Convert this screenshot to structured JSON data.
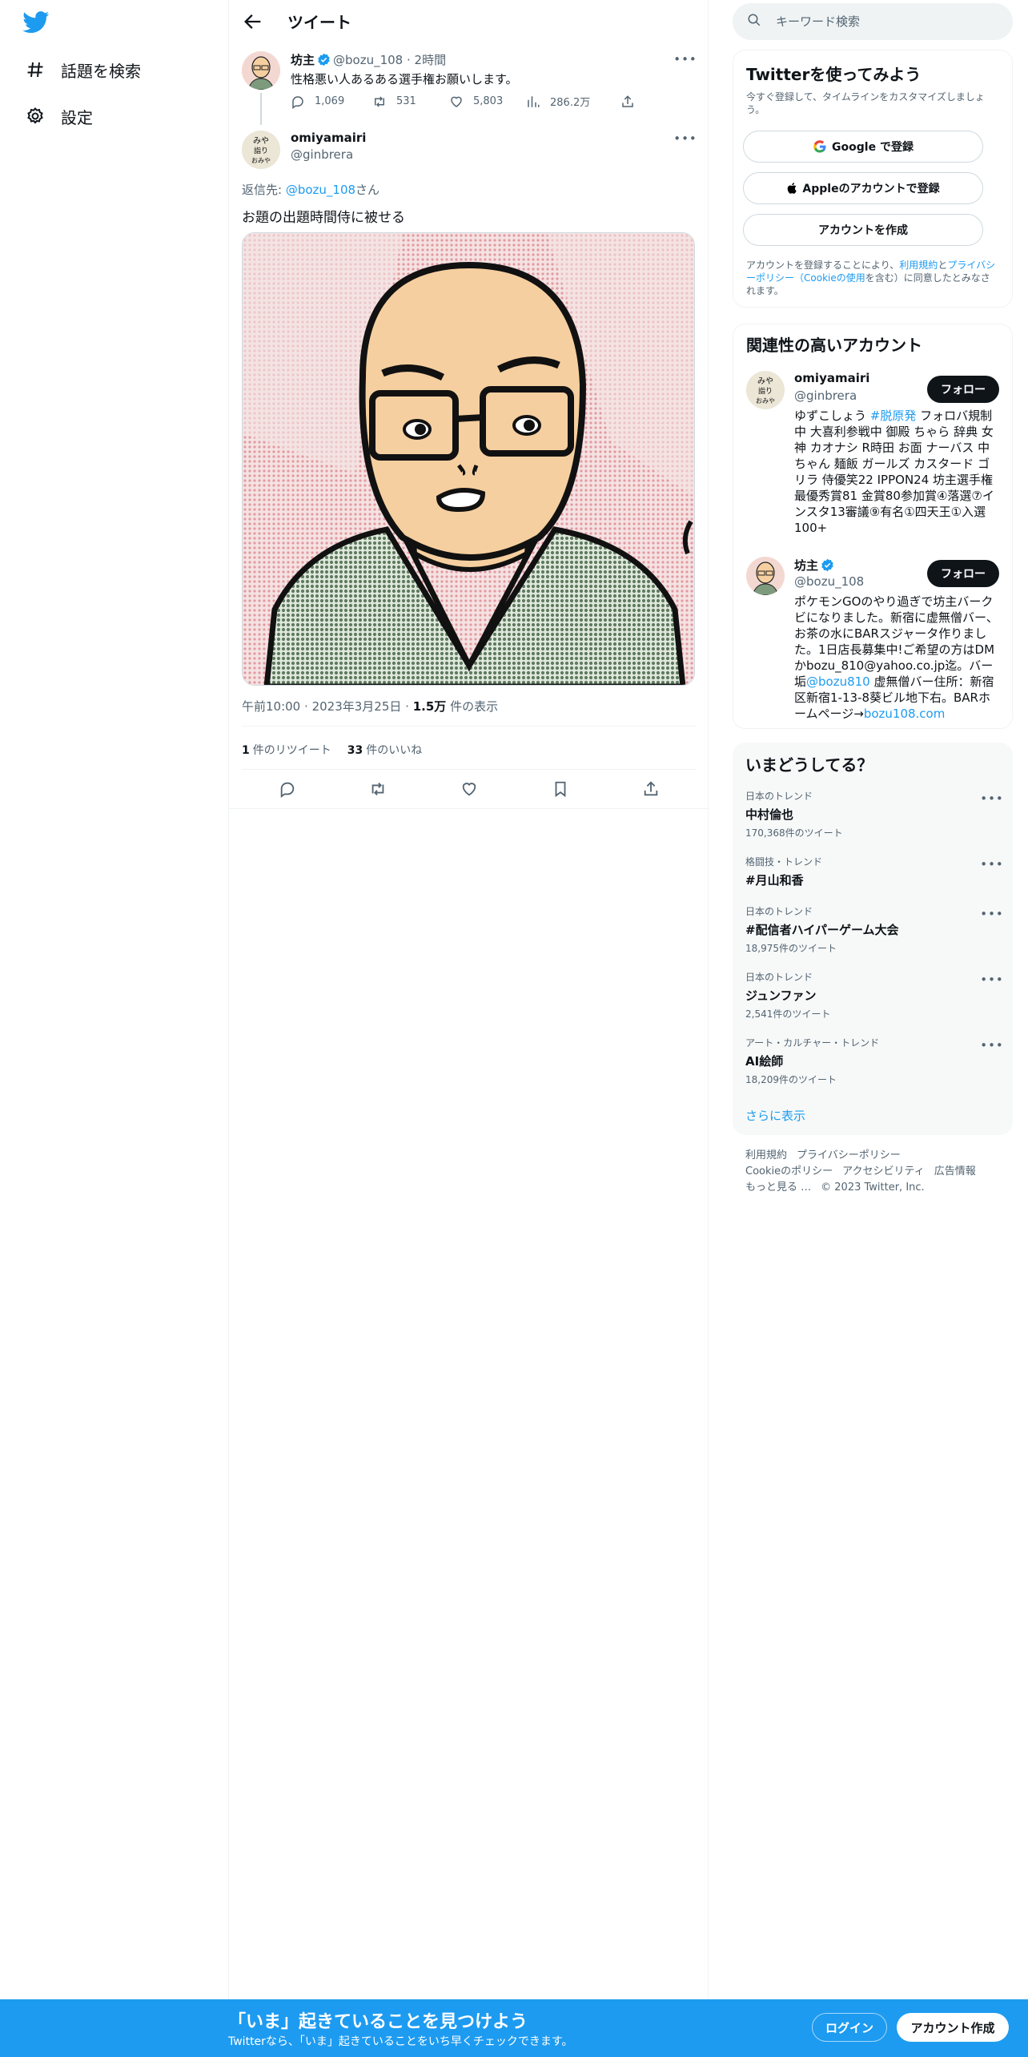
{
  "nav": {
    "explore": "話題を検索",
    "settings": "設定"
  },
  "header": {
    "title": "ツイート"
  },
  "tweet1": {
    "name": "坊主",
    "handle": "@bozu_108",
    "time": "2時間",
    "text": "性格悪い人あるある選手権お願いします。",
    "replies": "1,069",
    "retweets": "531",
    "likes": "5,803",
    "views": "286.2万"
  },
  "tweet2": {
    "name": "omiyamairi",
    "handle": "@ginbrera",
    "reply_prefix": "返信先: ",
    "reply_to": "@bozu_108",
    "reply_suffix": "さん",
    "text": "お題の出題時間侍に被せる",
    "time": "午前10:00",
    "date": "2023年3月25日",
    "views_count": "1.5万",
    "views_label": "件の表示",
    "retweet_count": "1",
    "retweet_label": "件のリツイート",
    "like_count": "33",
    "like_label": "件のいいね"
  },
  "search": {
    "placeholder": "キーワード検索"
  },
  "signup_card": {
    "title": "Twitterを使ってみよう",
    "desc": "今すぐ登録して、タイムラインをカスタマイズしましょう。",
    "google": "Google で登録",
    "apple": "Appleのアカウントで登録",
    "create": "アカウントを作成",
    "terms_1": "アカウントを登録することにより、",
    "terms_link1": "利用規約",
    "terms_2": "と",
    "terms_link2": "プライバシーポリシー（Cookieの使用",
    "terms_3": "を含む）に同意したとみなされます。"
  },
  "related": {
    "title": "関連性の高いアカウント",
    "follow_label": "フォロー",
    "accounts": [
      {
        "name": "omiyamairi",
        "handle": "@ginbrera",
        "bio_1": "ゆずこしょう ",
        "bio_tag": "#脱原発",
        "bio_2": " フォロバ規制中 大喜利参戦中 御殿 ちゃら 辞典 女神 カオナシ R時田 お面 ナーバス 中ちゃん 麺飯 ガールズ カスタード ゴリラ 侍優笑22 IPPON24 坊主選手権最優秀賞81 金賞80参加賞④落選⑦インスタ13審議⑨有名①四天王①入選100+"
      },
      {
        "name": "坊主",
        "handle": "@bozu_108",
        "bio_1": "ポケモンGOのやり過ぎで坊主バークビになりました。新宿に虚無僧バー、お茶の水にBARスジャータ作りました。1日店長募集中!ご希望の方はDMかbozu_810@yahoo.co.jp迄。バー垢",
        "bio_mention": "@bozu810",
        "bio_2": " 虚無僧バー住所：新宿区新宿1-13-8葵ビル地下右。BARホームページ→",
        "bio_link": "bozu108.com"
      }
    ]
  },
  "trends": {
    "title": "いまどうしてる？",
    "items": [
      {
        "category": "日本のトレンド",
        "topic": "中村倫也",
        "count": "170,368件のツイート"
      },
      {
        "category": "格闘技・トレンド",
        "topic": "#月山和香",
        "count": ""
      },
      {
        "category": "日本のトレンド",
        "topic": "#配信者ハイパーゲーム大会",
        "count": "18,975件のツイート"
      },
      {
        "category": "日本のトレンド",
        "topic": "ジュンファン",
        "count": "2,541件のツイート"
      },
      {
        "category": "アート・カルチャー・トレンド",
        "topic": "AI絵師",
        "count": "18,209件のツイート"
      }
    ],
    "show_more": "さらに表示"
  },
  "footer": {
    "links": [
      "利用規約",
      "プライバシーポリシー",
      "Cookieのポリシー",
      "アクセシビリティ",
      "広告情報",
      "もっと見る …"
    ],
    "copyright": "© 2023 Twitter, Inc."
  },
  "bottom_bar": {
    "title": "「いま」起きていることを見つけよう",
    "subtitle": "Twitterなら、「いま」起きていることをいち早くチェックできます。",
    "login": "ログイン",
    "signup": "アカウント作成"
  },
  "colors": {
    "accent": "#1d9bf0",
    "text": "#0f1419",
    "secondary": "#536471",
    "border": "#eff3f4"
  }
}
